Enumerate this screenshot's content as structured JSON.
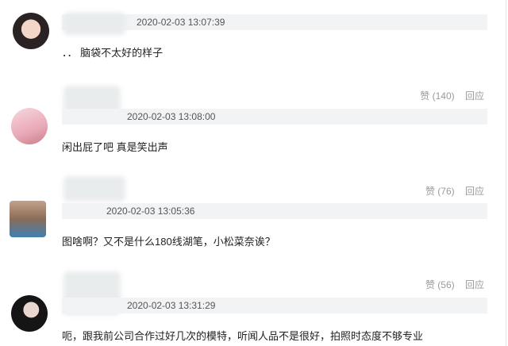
{
  "comments": [
    {
      "timestamp": "2020-02-03 13:07:39",
      "text": "．． 脑袋不太好的样子",
      "likes": "赞 (140)",
      "reply": "回应"
    },
    {
      "timestamp": "2020-02-03 13:08:00",
      "text": "闲出屁了吧 真是笑出声",
      "likes": "赞 (76)",
      "reply": "回应"
    },
    {
      "timestamp": "2020-02-03 13:05:36",
      "text": "图啥啊？又不是什么180线湖笔，小松菜奈诶？",
      "likes": "赞 (56)",
      "reply": "回应"
    },
    {
      "timestamp": "2020-02-03 13:31:29",
      "text": "呃，跟我前公司合作过好几次的模特，听闻人品不是很好，拍照时态度不够专业"
    }
  ]
}
